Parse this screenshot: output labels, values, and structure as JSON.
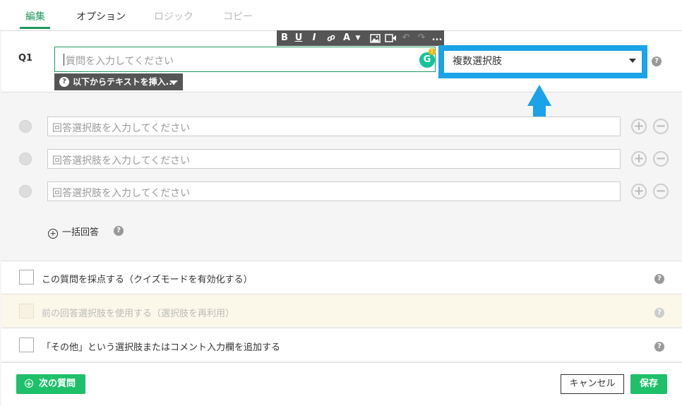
{
  "tabs": [
    {
      "label": "編集",
      "state": "active"
    },
    {
      "label": "オプション",
      "state": "normal"
    },
    {
      "label": "ロジック",
      "state": "disabled"
    },
    {
      "label": "コピー",
      "state": "disabled"
    }
  ],
  "question": {
    "number": "Q1",
    "placeholder": "質問を入力してください",
    "pipe_button_label": "以下からテキストを挿入...",
    "type_selected": "複数選択肢"
  },
  "toolbar": {
    "bold": "B",
    "underline": "U",
    "italic": "I",
    "font_color": "A",
    "more": "..."
  },
  "answers": [
    {
      "placeholder": "回答選択肢を入力してください"
    },
    {
      "placeholder": "回答選択肢を入力してください"
    },
    {
      "placeholder": "回答選択肢を入力してください"
    }
  ],
  "bulk_answer_label": "一括回答",
  "options": [
    {
      "label": "この質問を採点する（クイズモードを有効化する）",
      "enabled": true
    },
    {
      "label": "前の回答選択肢を使用する（選択肢を再利用）",
      "enabled": false
    },
    {
      "label": "「その他」という選択肢またはコメント入力欄を追加する",
      "enabled": true
    }
  ],
  "footer": {
    "next_question_label": "次の質問",
    "cancel_label": "キャンセル",
    "save_label": "保存"
  },
  "colors": {
    "accent_green": "#1ec06a",
    "highlight_blue": "#1aa3e8"
  }
}
